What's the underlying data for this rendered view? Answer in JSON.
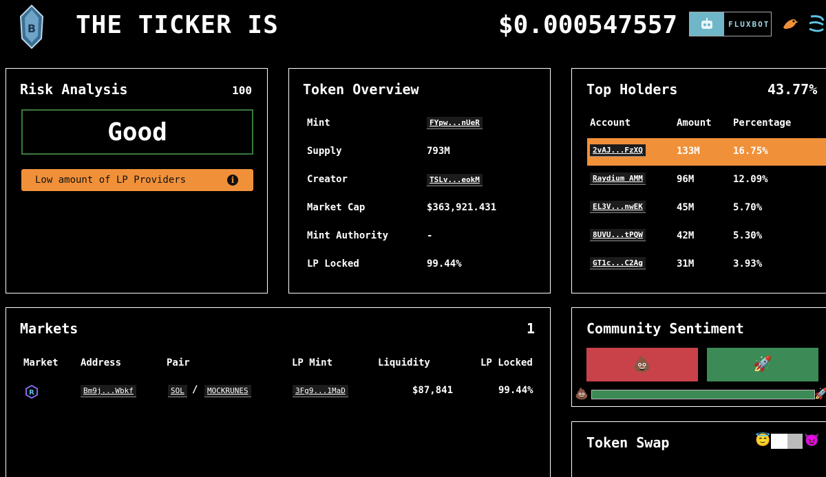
{
  "header": {
    "title": "THE TICKER IS",
    "price": "$0.000547557",
    "fluxbot_label": "FLUXBOT"
  },
  "risk": {
    "title": "Risk Analysis",
    "score": "100",
    "rating": "Good",
    "warning": "Low amount of LP Providers"
  },
  "overview": {
    "title": "Token Overview",
    "rows": [
      {
        "label": "Mint",
        "value": "FYpw...nUeR",
        "tag": true
      },
      {
        "label": "Supply",
        "value": "793M",
        "tag": false
      },
      {
        "label": "Creator",
        "value": "TSLv...eokM",
        "tag": true
      },
      {
        "label": "Market Cap",
        "value": "$363,921.431",
        "tag": false
      },
      {
        "label": "Mint Authority",
        "value": "-",
        "tag": false
      },
      {
        "label": "LP Locked",
        "value": "99.44%",
        "tag": false
      }
    ]
  },
  "holders": {
    "title": "Top Holders",
    "total": "43.77%",
    "columns": [
      "Account",
      "Amount",
      "Percentage"
    ],
    "rows": [
      {
        "account": "2vAJ...FzXQ",
        "amount": "133M",
        "pct": "16.75%"
      },
      {
        "account": "Raydium AMM",
        "amount": "96M",
        "pct": "12.09%"
      },
      {
        "account": "EL3V...nwEK",
        "amount": "45M",
        "pct": "5.70%"
      },
      {
        "account": "8UVU...tPQW",
        "amount": "42M",
        "pct": "5.30%"
      },
      {
        "account": "GT1c...C2Ag",
        "amount": "31M",
        "pct": "3.93%"
      }
    ]
  },
  "markets": {
    "title": "Markets",
    "count": "1",
    "columns": {
      "market": "Market",
      "address": "Address",
      "pair": "Pair",
      "lp_mint": "LP Mint",
      "liquidity": "Liquidity",
      "lp_locked": "LP Locked"
    },
    "rows": [
      {
        "address": "Bm9j...Wbkf",
        "base": "SOL",
        "sep": "/",
        "quote": "MOCKRUNES",
        "lp_mint": "3Fg9...1MaD",
        "liquidity": "$87,841",
        "lp_locked": "99.44%"
      }
    ]
  },
  "sentiment": {
    "title": "Community Sentiment",
    "bad_emoji": "💩",
    "good_emoji": "🚀",
    "good_share": 1.0,
    "bad_color": "#c9424a",
    "good_color": "#3c8a55"
  },
  "swap": {
    "title": "Token Swap",
    "angel_emoji": "😇",
    "devil_emoji": "😈"
  },
  "colors": {
    "accent_orange": "#f0913a",
    "good_border": "#3a7a3e"
  }
}
